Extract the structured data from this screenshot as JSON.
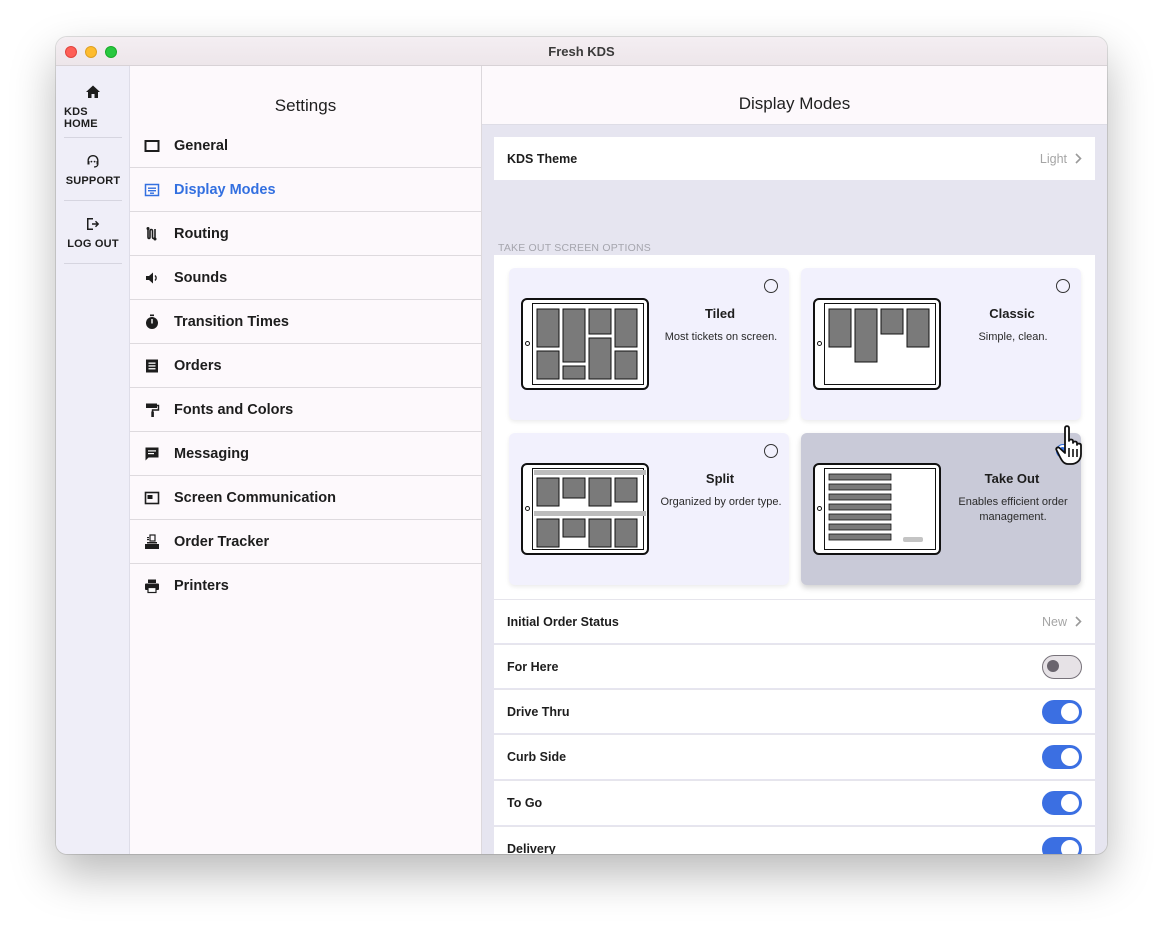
{
  "app": {
    "title": "Fresh KDS"
  },
  "rail": [
    {
      "label": "KDS HOME",
      "icon": "home-icon"
    },
    {
      "label": "SUPPORT",
      "icon": "support-icon"
    },
    {
      "label": "LOG OUT",
      "icon": "logout-icon"
    }
  ],
  "settings": {
    "title": "Settings",
    "items": [
      {
        "label": "General",
        "icon": "general-icon"
      },
      {
        "label": "Display Modes",
        "icon": "display-modes-icon",
        "active": true
      },
      {
        "label": "Routing",
        "icon": "routing-icon"
      },
      {
        "label": "Sounds",
        "icon": "sounds-icon"
      },
      {
        "label": "Transition Times",
        "icon": "timer-icon"
      },
      {
        "label": "Orders",
        "icon": "orders-icon"
      },
      {
        "label": "Fonts and Colors",
        "icon": "paint-roller-icon"
      },
      {
        "label": "Messaging",
        "icon": "messaging-icon"
      },
      {
        "label": "Screen Communication",
        "icon": "screen-communication-icon"
      },
      {
        "label": "Order Tracker",
        "icon": "order-tracker-icon"
      },
      {
        "label": "Printers",
        "icon": "printer-icon"
      }
    ]
  },
  "detail": {
    "title": "Display Modes",
    "kds_theme": {
      "label": "KDS Theme",
      "value": "Light"
    },
    "section_label": "TAKE OUT SCREEN OPTIONS",
    "modes": [
      {
        "name": "Tiled",
        "description": "Most tickets on screen.",
        "selected": false
      },
      {
        "name": "Classic",
        "description": "Simple, clean.",
        "selected": false
      },
      {
        "name": "Split",
        "description": "Organized by order type.",
        "selected": false
      },
      {
        "name": "Take Out",
        "description": "Enables efficient order management.",
        "selected": true
      }
    ],
    "initial_order_status": {
      "label": "Initial Order Status",
      "value": "New"
    },
    "toggles": [
      {
        "label": "For Here",
        "on": false
      },
      {
        "label": "Drive Thru",
        "on": true
      },
      {
        "label": "Curb Side",
        "on": true
      },
      {
        "label": "To Go",
        "on": true
      },
      {
        "label": "Delivery",
        "on": true
      }
    ]
  },
  "colors": {
    "accent": "#3b6fe2",
    "selected_card": "#c9cad8",
    "card": "#f2f1fd"
  }
}
